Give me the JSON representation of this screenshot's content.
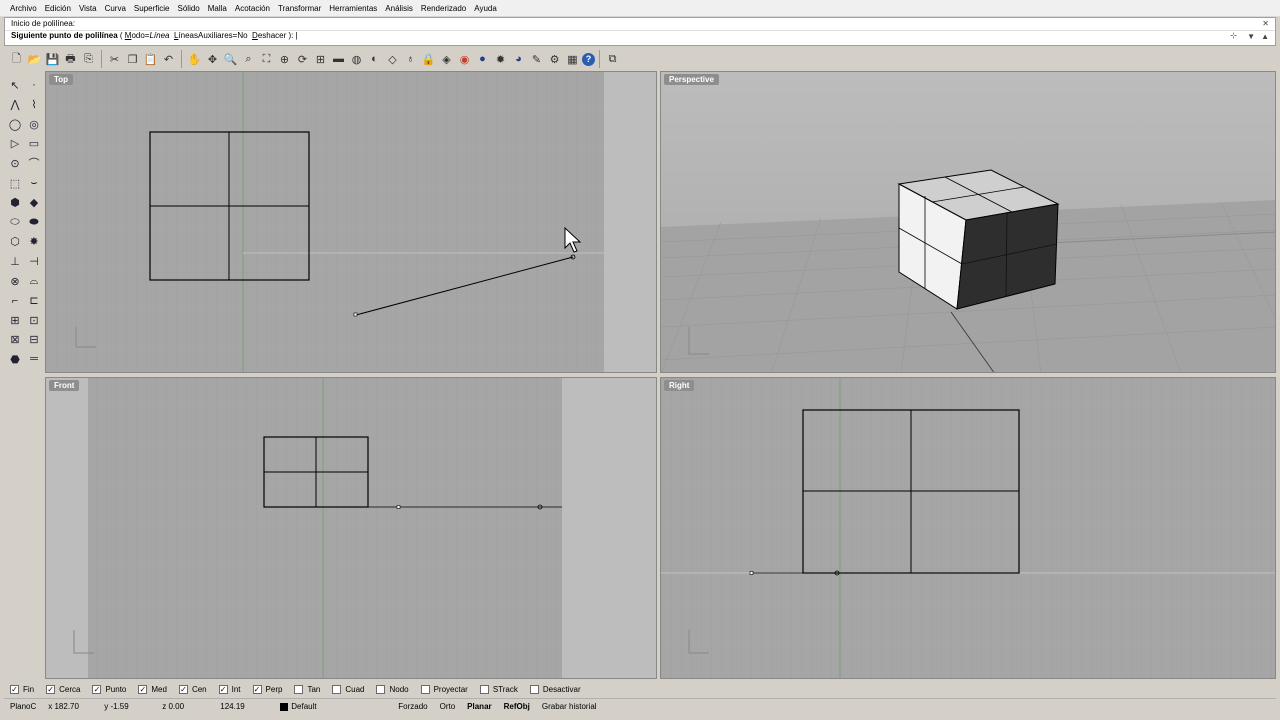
{
  "menu": [
    "Archivo",
    "Edición",
    "Vista",
    "Curva",
    "Superficie",
    "Sólido",
    "Malla",
    "Acotación",
    "Transformar",
    "Herramientas",
    "Análisis",
    "Renderizado",
    "Ayuda"
  ],
  "command": {
    "history": "Inicio de polilínea:",
    "prompt_bold": "Siguiente punto de polilínea",
    "prompt_open": " ( ",
    "opt1_key": "M",
    "opt1_rest": "odo=",
    "opt1_val": "Línea",
    "opt2_key": "L",
    "opt2_rest": "íneasAuxiliares=No",
    "opt3_key": "D",
    "opt3_rest": "eshacer",
    "prompt_close": " ): |"
  },
  "toolbar_icons": [
    "new-icon",
    "open-icon",
    "save-icon",
    "print-icon",
    "import-icon",
    "cut-icon",
    "copy-icon",
    "paste-icon",
    "undo-icon",
    "pan-hand-icon",
    "move-icon",
    "zoom-icon",
    "zoom-window-icon",
    "zoom-extents-icon",
    "zoom-selected-icon",
    "rotate-view-icon",
    "four-views-icon",
    "car-icon",
    "render-icon",
    "shade-icon",
    "point-icon",
    "light-icon",
    "lock-icon",
    "material-icon",
    "color-icon",
    "sphere-icon",
    "gear-sphere-icon",
    "blue-sphere-icon",
    "brush-icon",
    "settings-icon",
    "grid-icon",
    "help-icon",
    "camera-icon"
  ],
  "viewports": {
    "top": {
      "label": "Top"
    },
    "perspective": {
      "label": "Perspective"
    },
    "front": {
      "label": "Front"
    },
    "right": {
      "label": "Right"
    }
  },
  "snaps": [
    {
      "label": "Fin",
      "checked": true
    },
    {
      "label": "Cerca",
      "checked": true
    },
    {
      "label": "Punto",
      "checked": true
    },
    {
      "label": "Med",
      "checked": true
    },
    {
      "label": "Cen",
      "checked": true
    },
    {
      "label": "Int",
      "checked": true
    },
    {
      "label": "Perp",
      "checked": true
    },
    {
      "label": "Tan",
      "checked": false
    },
    {
      "label": "Cuad",
      "checked": false
    },
    {
      "label": "Nodo",
      "checked": false
    },
    {
      "label": "Proyectar",
      "checked": false
    },
    {
      "label": "STrack",
      "checked": false
    },
    {
      "label": "Desactivar",
      "checked": false
    }
  ],
  "status": {
    "cplane": "PlanoC",
    "x": "x 182.70",
    "y": "y -1.59",
    "z": "z 0.00",
    "dist": "124.19",
    "layer": "Default",
    "forzado": "Forzado",
    "orto": "Orto",
    "planar": "Planar",
    "refobj": "RefObj",
    "history": "Grabar historial"
  },
  "colors": {
    "viewport_bg": "#a6a6a6",
    "viewport_inactive": "#bdbdbd",
    "grid_minor": "#9c9c9c",
    "grid_major": "#8e8e8e",
    "label_bg": "#8e8e8e"
  }
}
